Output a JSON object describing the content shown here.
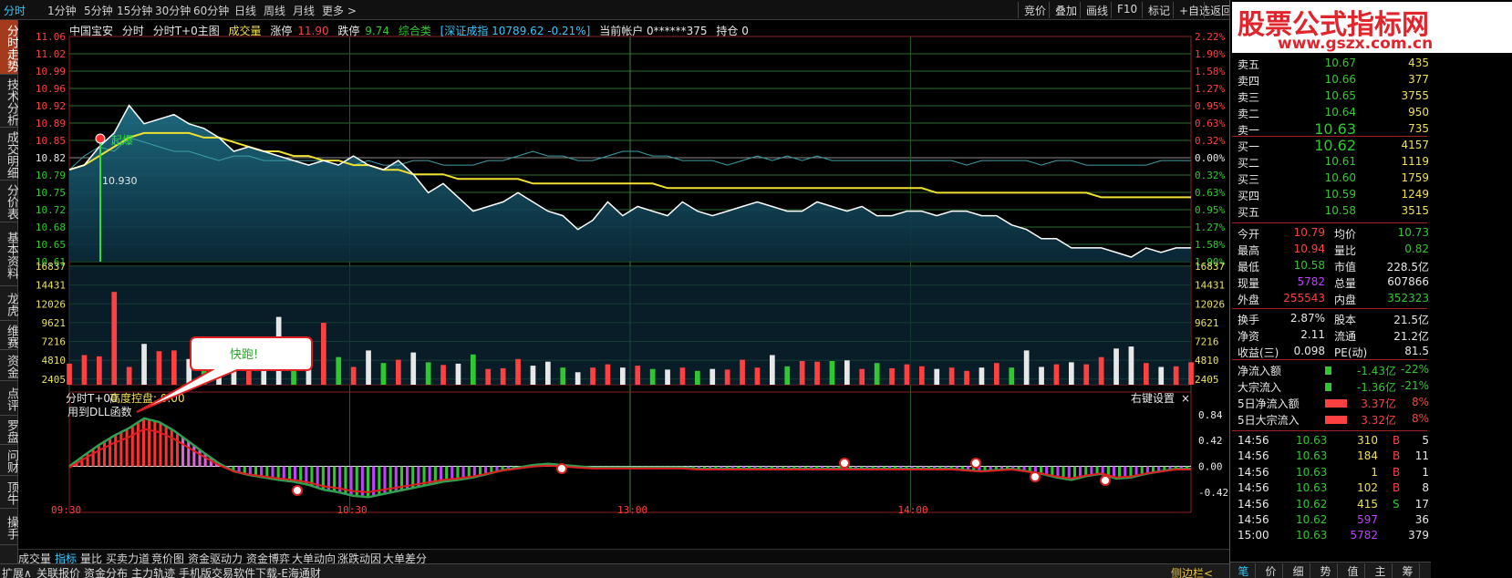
{
  "top_tabs": [
    "分时",
    "1分钟",
    "5分钟",
    "15分钟",
    "30分钟",
    "60分钟",
    "日线",
    "周线",
    "月线",
    "更多 >"
  ],
  "top_right_buttons": [
    "竞价",
    "叠加",
    "画线",
    "F10",
    "标记",
    "+自选",
    "返回"
  ],
  "left_tabs": [
    "分时走势",
    "技术分析",
    "成交明细",
    "分价表",
    "基本资料",
    "龙虎",
    "维赛",
    "资金",
    "点评",
    "罗盘",
    "问财",
    "顶牛",
    "操手"
  ],
  "info_line": {
    "name": "中国宝安",
    "mode": "分时",
    "mode2": "分时T+0主图",
    "volume_label": "成交量",
    "limit_up_label": "涨停",
    "limit_up": "11.90",
    "limit_down_label": "跌停",
    "limit_down": "9.74",
    "category": "综合类",
    "index": "[深证成指 10789.62 -0.21%]",
    "account": "当前帐户 0******375",
    "position": "持仓 0"
  },
  "price_axis_left": [
    "11.06",
    "11.02",
    "10.99",
    "10.96",
    "10.92",
    "10.89",
    "10.85",
    "10.82",
    "10.79",
    "10.75",
    "10.72",
    "10.68",
    "10.65",
    "10.61"
  ],
  "pct_axis_right": [
    "2.22%",
    "1.90%",
    "1.58%",
    "1.27%",
    "0.95%",
    "0.63%",
    "0.32%",
    "0.00%",
    "0.32%",
    "0.63%",
    "0.95%",
    "1.27%",
    "1.58%",
    "1.90%"
  ],
  "volume_axis": [
    "16837",
    "14431",
    "12026",
    "9621",
    "7216",
    "4810",
    "2405"
  ],
  "annotations": {
    "qibao": "起爆",
    "price_marker": "10.930",
    "bubble": "快跑!",
    "indicator_title": "分时T+00",
    "indicator_param": "高度控盘: 0.00",
    "indicator_sub": "用到DLL函数",
    "settings": "右键设置",
    "close": "×"
  },
  "indicator_axis": [
    "0.84",
    "0.42",
    "0.00",
    "-0.42"
  ],
  "time_axis": [
    "09:30",
    "10:30",
    "13:00",
    "14:00"
  ],
  "bottom_tabs": [
    "成交量",
    "指标",
    "量比",
    "买卖力道",
    "竞价图",
    "资金驱动力",
    "资金博弈",
    "大单动向",
    "涨跌动因",
    "大单差分"
  ],
  "status_items": [
    "扩展∧",
    "关联报价",
    "资金分布",
    "主力轨迹",
    "手机版交易软件下载-E海通财"
  ],
  "status_right": "侧边栏<",
  "logo": {
    "line1": "股票公式指标网",
    "line2": "www.gszx.com.cn"
  },
  "sell_orders": [
    {
      "label": "卖五",
      "price": "10.67",
      "vol": "435"
    },
    {
      "label": "卖四",
      "price": "10.66",
      "vol": "377"
    },
    {
      "label": "卖三",
      "price": "10.65",
      "vol": "3755"
    },
    {
      "label": "卖二",
      "price": "10.64",
      "vol": "950"
    },
    {
      "label": "卖一",
      "price": "10.63",
      "vol": "735"
    }
  ],
  "buy_orders": [
    {
      "label": "买一",
      "price": "10.62",
      "vol": "4157"
    },
    {
      "label": "买二",
      "price": "10.61",
      "vol": "1119"
    },
    {
      "label": "买三",
      "price": "10.60",
      "vol": "1759"
    },
    {
      "label": "买四",
      "price": "10.59",
      "vol": "1249"
    },
    {
      "label": "买五",
      "price": "10.58",
      "vol": "3515"
    }
  ],
  "stats": [
    {
      "k1": "今开",
      "v1": "10.79",
      "c1": "#ff4040",
      "k2": "均价",
      "v2": "10.73",
      "c2": "#30c830"
    },
    {
      "k1": "最高",
      "v1": "10.94",
      "c1": "#ff4040",
      "k2": "量比",
      "v2": "0.82",
      "c2": "#30c830"
    },
    {
      "k1": "最低",
      "v1": "10.58",
      "c1": "#30c830",
      "k2": "市值",
      "v2": "228.5亿",
      "c2": "#e8e8e8"
    },
    {
      "k1": "现量",
      "v1": "5782",
      "c1": "#c040ff",
      "k2": "总量",
      "v2": "607866",
      "c2": "#e8e8e8"
    },
    {
      "k1": "外盘",
      "v1": "255543",
      "c1": "#ff4040",
      "k2": "内盘",
      "v2": "352323",
      "c2": "#30c830"
    },
    {
      "k1": "换手",
      "v1": "2.87%",
      "c1": "#e8e8e8",
      "k2": "股本",
      "v2": "21.5亿",
      "c2": "#e8e8e8"
    },
    {
      "k1": "净资",
      "v1": "2.11",
      "c1": "#e8e8e8",
      "k2": "流通",
      "v2": "21.2亿",
      "c2": "#e8e8e8"
    },
    {
      "k1": "收益(三)",
      "v1": "0.098",
      "c1": "#e8e8e8",
      "k2": "PE(动)",
      "v2": "81.5",
      "c2": "#e8e8e8"
    }
  ],
  "flows": [
    {
      "label": "净流入额",
      "value": "-1.43亿",
      "pct": "-22%",
      "color": "#30c830",
      "bar": 0.12
    },
    {
      "label": "大宗流入",
      "value": "-1.36亿",
      "pct": "-21%",
      "color": "#30c830",
      "bar": 0.12
    },
    {
      "label": "5日净流入额",
      "value": "3.37亿",
      "pct": "8%",
      "color": "#ff4040",
      "bar": 0.9
    },
    {
      "label": "5日大宗流入",
      "value": "3.32亿",
      "pct": "8%",
      "color": "#ff4040",
      "bar": 0.9
    }
  ],
  "ticks": [
    {
      "time": "14:56",
      "price": "10.63",
      "vol": "310",
      "vc": "#f0e050",
      "bs": "B",
      "bc": "#ff4040",
      "n": "5"
    },
    {
      "time": "14:56",
      "price": "10.63",
      "vol": "184",
      "vc": "#f0e050",
      "bs": "B",
      "bc": "#ff4040",
      "n": "11"
    },
    {
      "time": "14:56",
      "price": "10.63",
      "vol": "1",
      "vc": "#f0e050",
      "bs": "B",
      "bc": "#ff4040",
      "n": "1"
    },
    {
      "time": "14:56",
      "price": "10.63",
      "vol": "102",
      "vc": "#f0e050",
      "bs": "B",
      "bc": "#ff4040",
      "n": "8"
    },
    {
      "time": "14:56",
      "price": "10.62",
      "vol": "415",
      "vc": "#f0e050",
      "bs": "S",
      "bc": "#30c830",
      "n": "17"
    },
    {
      "time": "14:56",
      "price": "10.62",
      "vol": "597",
      "vc": "#c040ff",
      "bs": "",
      "bc": "#30c830",
      "n": "36"
    },
    {
      "time": "15:00",
      "price": "10.63",
      "vol": "5782",
      "vc": "#c040ff",
      "bs": "",
      "bc": "#30c830",
      "n": "379"
    }
  ],
  "right_tabs": [
    "笔",
    "价",
    "细",
    "势",
    "值",
    "主",
    "筹"
  ],
  "chart_data": {
    "type": "line",
    "price_series": [
      10.79,
      10.8,
      10.84,
      10.87,
      10.93,
      10.89,
      10.9,
      10.91,
      10.89,
      10.88,
      10.86,
      10.83,
      10.84,
      10.83,
      10.82,
      10.81,
      10.8,
      10.81,
      10.8,
      10.82,
      10.8,
      10.79,
      10.81,
      10.78,
      10.74,
      10.76,
      10.73,
      10.7,
      10.71,
      10.72,
      10.74,
      10.72,
      10.7,
      10.69,
      10.66,
      10.68,
      10.72,
      10.69,
      10.71,
      10.7,
      10.69,
      10.72,
      10.7,
      10.69,
      10.7,
      10.71,
      10.72,
      10.71,
      10.7,
      10.7,
      10.72,
      10.71,
      10.7,
      10.71,
      10.69,
      10.69,
      10.7,
      10.7,
      10.69,
      10.7,
      10.7,
      10.69,
      10.69,
      10.67,
      10.66,
      10.64,
      10.64,
      10.62,
      10.62,
      10.62,
      10.61,
      10.6,
      10.62,
      10.61,
      10.62,
      10.62
    ],
    "avg_series": [
      10.79,
      10.8,
      10.82,
      10.84,
      10.86,
      10.87,
      10.87,
      10.87,
      10.87,
      10.86,
      10.86,
      10.85,
      10.84,
      10.83,
      10.83,
      10.82,
      10.82,
      10.81,
      10.81,
      10.8,
      10.8,
      10.79,
      10.79,
      10.78,
      10.78,
      10.78,
      10.77,
      10.77,
      10.77,
      10.77,
      10.77,
      10.76,
      10.76,
      10.76,
      10.76,
      10.76,
      10.76,
      10.76,
      10.76,
      10.76,
      10.75,
      10.75,
      10.75,
      10.75,
      10.75,
      10.75,
      10.75,
      10.75,
      10.75,
      10.75,
      10.75,
      10.75,
      10.75,
      10.75,
      10.75,
      10.75,
      10.75,
      10.75,
      10.74,
      10.74,
      10.74,
      10.74,
      10.74,
      10.74,
      10.74,
      10.74,
      10.74,
      10.74,
      10.74,
      10.73,
      10.73,
      10.73,
      10.73,
      10.73,
      10.73,
      10.73
    ],
    "index_series": [
      10.79,
      10.82,
      10.84,
      10.83,
      10.86,
      10.85,
      10.84,
      10.83,
      10.83,
      10.82,
      10.81,
      10.82,
      10.82,
      10.81,
      10.81,
      10.81,
      10.81,
      10.81,
      10.81,
      10.8,
      10.81,
      10.8,
      10.8,
      10.81,
      10.81,
      10.8,
      10.8,
      10.8,
      10.81,
      10.81,
      10.82,
      10.83,
      10.82,
      10.82,
      10.81,
      10.81,
      10.82,
      10.83,
      10.83,
      10.82,
      10.82,
      10.81,
      10.81,
      10.81,
      10.8,
      10.81,
      10.82,
      10.81,
      10.82,
      10.81,
      10.82,
      10.81,
      10.81,
      10.81,
      10.81,
      10.81,
      10.81,
      10.81,
      10.81,
      10.81,
      10.8,
      10.81,
      10.81,
      10.81,
      10.81,
      10.8,
      10.81,
      10.81,
      10.8,
      10.8,
      10.8,
      10.8,
      10.8,
      10.81,
      10.81,
      10.81
    ],
    "volume_series": [
      3200,
      4500,
      4300,
      14100,
      2700,
      6200,
      5100,
      5200,
      3900,
      4000,
      6800,
      4300,
      7100,
      4300,
      10300,
      4000,
      3200,
      9400,
      4200,
      2700,
      5200,
      3300,
      3800,
      4900,
      3400,
      3000,
      3200,
      4600,
      2400,
      2500,
      3900,
      2900,
      3500,
      2600,
      1900,
      2600,
      3100,
      2600,
      2900,
      2400,
      2300,
      2600,
      2100,
      2400,
      2300,
      3800,
      2600,
      4500,
      2800,
      3600,
      3500,
      3600,
      3700,
      2400,
      3300,
      2500,
      3100,
      2800,
      2400,
      2600,
      2100,
      2600,
      3300,
      2600,
      5200,
      2700,
      3100,
      3400,
      3100,
      4200,
      5500,
      5800,
      3300,
      2700,
      2800,
      3400
    ],
    "indicator_series": [
      0.0,
      0.18,
      0.35,
      0.5,
      0.62,
      0.78,
      0.72,
      0.58,
      0.4,
      0.22,
      0.05,
      -0.08,
      -0.14,
      -0.18,
      -0.22,
      -0.25,
      -0.3,
      -0.38,
      -0.42,
      -0.48,
      -0.5,
      -0.45,
      -0.4,
      -0.35,
      -0.3,
      -0.25,
      -0.22,
      -0.18,
      -0.12,
      -0.06,
      -0.02,
      0.02,
      0.04,
      0.02,
      0.0,
      -0.02,
      -0.02,
      -0.02,
      -0.02,
      -0.02,
      -0.02,
      -0.02,
      -0.04,
      -0.04,
      -0.04,
      -0.04,
      -0.04,
      -0.04,
      -0.04,
      -0.04,
      -0.04,
      -0.04,
      -0.04,
      -0.04,
      -0.04,
      -0.04,
      -0.04,
      -0.04,
      -0.04,
      -0.04,
      -0.06,
      -0.08,
      -0.06,
      -0.04,
      -0.08,
      -0.12,
      -0.18,
      -0.22,
      -0.16,
      -0.12,
      -0.2,
      -0.18,
      -0.12,
      -0.08,
      -0.04,
      -0.04
    ],
    "ylim_price": [
      10.59,
      11.08
    ],
    "ylim_volume": [
      0,
      18000
    ],
    "ylim_indicator": [
      -0.6,
      1.0
    ]
  }
}
